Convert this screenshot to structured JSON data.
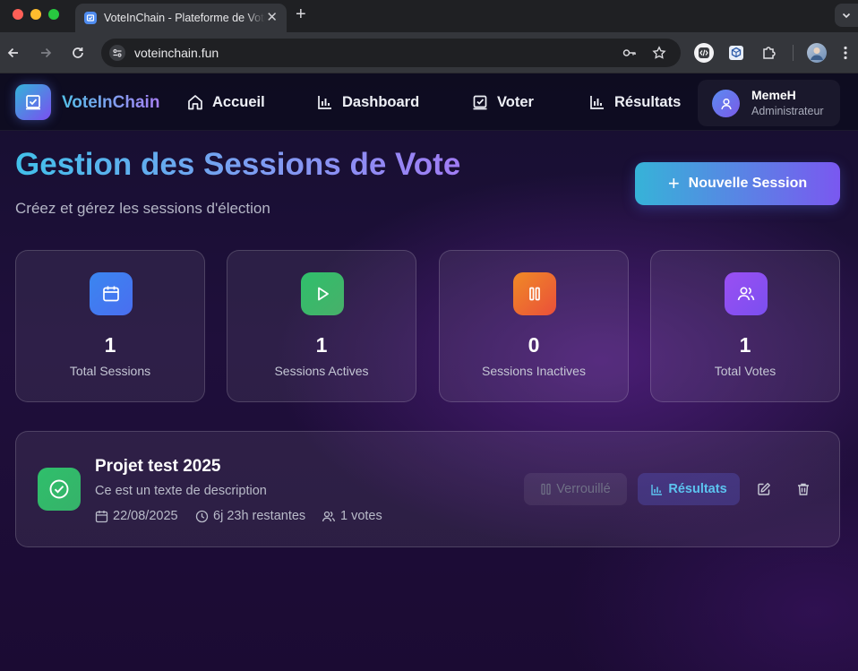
{
  "browser": {
    "tab_title": "VoteInChain - Plateforme de Vote",
    "url": "voteinchain.fun"
  },
  "nav": {
    "brand": "VoteInChain",
    "items": [
      {
        "label": "Accueil",
        "icon": "home-icon"
      },
      {
        "label": "Dashboard",
        "icon": "bar-chart-icon"
      },
      {
        "label": "Voter",
        "icon": "vote-icon"
      },
      {
        "label": "Résultats",
        "icon": "bar-chart-icon"
      }
    ],
    "user": {
      "name": "MemeH",
      "role": "Administrateur"
    }
  },
  "header": {
    "title": "Gestion des Sessions de Vote",
    "subtitle": "Créez et gérez les sessions d'élection",
    "new_session_label": "Nouvelle Session"
  },
  "stats": [
    {
      "value": "1",
      "label": "Total Sessions",
      "icon": "calendar-icon",
      "color": "#3f7ff0"
    },
    {
      "value": "1",
      "label": "Sessions Actives",
      "icon": "play-icon",
      "color": "#33b864"
    },
    {
      "value": "0",
      "label": "Sessions Inactives",
      "icon": "pause-icon",
      "color": "#f0672a"
    },
    {
      "value": "1",
      "label": "Total Votes",
      "icon": "users-icon",
      "color": "#8a4ff2"
    }
  ],
  "session": {
    "title": "Projet test 2025",
    "description": "Ce est un texte de description",
    "date": "22/08/2025",
    "remaining": "6j 23h restantes",
    "votes": "1 votes",
    "locked_label": "Verrouillé",
    "results_label": "Résultats"
  }
}
